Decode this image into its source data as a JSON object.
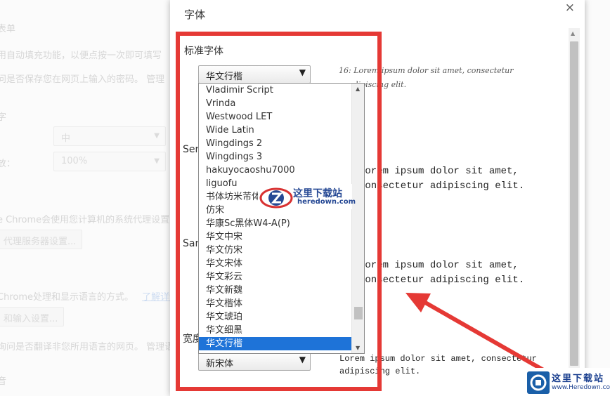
{
  "background": {
    "section_title": "表单",
    "autofill_desc": "用自动填充功能，以便点按一次即可填写",
    "password_desc": "问是否保存您在网页上输入的密码。 管理",
    "font_size_label": "字",
    "font_size_value": "中",
    "zoom_label": "放：",
    "zoom_value": "100%",
    "proxy_desc": "e Chrome会使用您计算机的系统代理设置",
    "proxy_button": "代理服务器设置...",
    "language_desc": "Chrome处理和显示语言的方式。",
    "language_link": "了解详情",
    "language_button": "和输入设置...",
    "translate_desc": "询问是否翻译非您所用语言的网页。 管理语",
    "bottom_label": "音"
  },
  "dialog": {
    "title": "字体",
    "close_glyph": "×",
    "standard_font": {
      "label": "标准字体",
      "value": "华文行楷",
      "preview": "16: Lorem ipsum dolor sit amet, consectetur adipiscing elit.",
      "preview_line1": "16: Lorem ipsum dolor sit amet, consectetur",
      "preview_line2": "adipiscing elit."
    },
    "serif_font": {
      "label_partial": "Ser",
      "preview_line1": "Lorem ipsum dolor sit amet,",
      "preview_line2": "consectetur adipiscing elit."
    },
    "sans_font": {
      "label_partial": "San",
      "preview_line1": "Lorem ipsum dolor sit amet,",
      "preview_line2": "consectetur adipiscing elit."
    },
    "fixed_width_font": {
      "label_partial": "宽度",
      "value": "新宋体",
      "preview_line1": "Lorem ipsum dolor sit amet, consectetur",
      "preview_line2": "adipiscing elit."
    },
    "dropdown_options": [
      "Vladimir Script",
      "Vrinda",
      "Westwood LET",
      "Wide Latin",
      "Wingdings 2",
      "Wingdings 3",
      "hakuyocaoshu7000",
      "liguofu",
      "书体坊米芾体",
      "仿宋",
      "华康Sc黑体W4-A(P)",
      "华文中宋",
      "华文仿宋",
      "华文宋体",
      "华文彩云",
      "华文新魏",
      "华文楷体",
      "华文琥珀",
      "华文细黑",
      "华文行楷"
    ],
    "dropdown_selected": "华文行楷"
  },
  "watermark": {
    "site_name": "这里下载站",
    "site_url": "heredown.com",
    "corner_name": "这里下载站",
    "corner_url": "www.Heredown.com"
  },
  "colors": {
    "highlight": "#e53935",
    "selection": "#1e73d8",
    "watermark_blue": "#1a3f8f"
  }
}
